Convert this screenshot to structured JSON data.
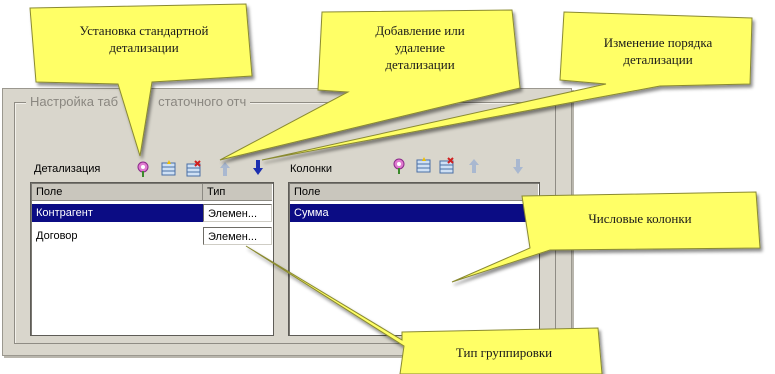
{
  "dialog": {
    "group_title": "Настройка таб",
    "group_title_tail": "статочного отч"
  },
  "left_panel": {
    "label": "Детализация",
    "toolbar": [
      "standard-detail-icon",
      "add-detail-icon",
      "remove-detail-icon",
      "move-up-icon",
      "move-down-icon"
    ],
    "headers": [
      "Поле",
      "Тип"
    ],
    "rows": [
      {
        "field": "Контрагент",
        "type": "Элемен..."
      },
      {
        "field": "Договор",
        "type": "Элемен..."
      }
    ]
  },
  "right_panel": {
    "label": "Колонки",
    "toolbar": [
      "standard-detail-icon",
      "add-detail-icon",
      "remove-detail-icon",
      "move-up-icon",
      "move-down-icon"
    ],
    "headers": [
      "Поле"
    ],
    "rows": [
      {
        "field": "Сумма"
      }
    ]
  },
  "callouts": {
    "standard": [
      "Установка стандартной",
      "детализации"
    ],
    "add_remove": [
      "Добавление или",
      "удаление",
      "детализации"
    ],
    "order": [
      "Изменение порядка",
      "детализации"
    ],
    "numeric": [
      "Числовые колонки"
    ],
    "grouping": [
      "Тип группировки"
    ]
  },
  "colors": {
    "callout_fill": "#ffff66",
    "selection": "#0b0c84",
    "panel": "#d9d6cc"
  }
}
